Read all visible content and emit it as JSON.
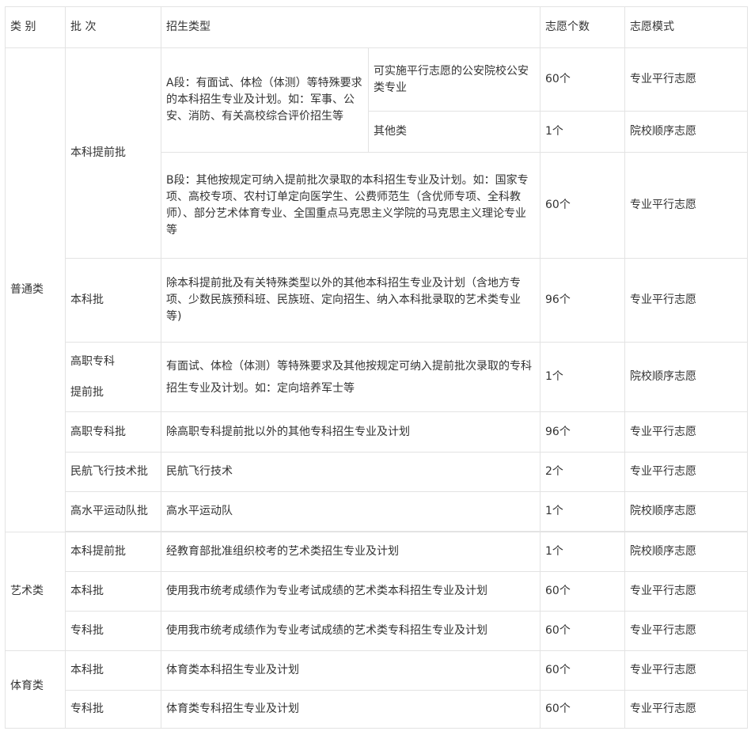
{
  "header": {
    "category": "类 别",
    "batch": "批 次",
    "type": "招生类型",
    "count": "志愿个数",
    "mode": "志愿模式"
  },
  "putong": {
    "category": "普通类",
    "benke_tiqian": {
      "batch": "本科提前批",
      "a_section": "A段：有面试、体检（体测）等特殊要求的本科招生专业及计划。如：军事、公安、消防、有关高校综合评价招生等",
      "a1": {
        "type": "可实施平行志愿的公安院校公安类专业",
        "count": "60个",
        "mode": "专业平行志愿"
      },
      "a2": {
        "type": "其他类",
        "count": "1个",
        "mode": "院校顺序志愿"
      },
      "b": {
        "type": "B段：其他按规定可纳入提前批次录取的本科招生专业及计划。如：国家专项、高校专项、农村订单定向医学生、公费师范生（含优师专项、全科教师）、部分艺术体育专业、全国重点马克思主义学院的马克思主义理论专业等",
        "count": "60个",
        "mode": "专业平行志愿"
      }
    },
    "benke": {
      "batch": "本科批",
      "type": "除本科提前批及有关特殊类型以外的其他本科招生专业及计划（含地方专项、少数民族预科班、民族班、定向招生、纳入本科批录取的艺术类专业等)",
      "count": "96个",
      "mode": "专业平行志愿"
    },
    "gaozhi_tiqian": {
      "batch_line1": "高职专科",
      "batch_line2": "提前批",
      "type": "有面试、体检（体测）等特殊要求及其他按规定可纳入提前批次录取的专科招生专业及计划。如：定向培养军士等",
      "count": "1个",
      "mode": "院校顺序志愿"
    },
    "gaozhi": {
      "batch": "高职专科批",
      "type": "除高职专科提前批以外的其他专科招生专业及计划",
      "count": "96个",
      "mode": "专业平行志愿"
    },
    "minhang": {
      "batch": "民航飞行技术批",
      "type": "民航飞行技术",
      "count": "2个",
      "mode": "专业平行志愿"
    },
    "gaoshuiping": {
      "batch": "高水平运动队批",
      "type": "高水平运动队",
      "count": "1个",
      "mode": "院校顺序志愿"
    }
  },
  "yishu": {
    "category": "艺术类",
    "rows": [
      {
        "batch": "本科提前批",
        "type": "经教育部批准组织校考的艺术类招生专业及计划",
        "count": "1个",
        "mode": "院校顺序志愿"
      },
      {
        "batch": "本科批",
        "type": "使用我市统考成绩作为专业考试成绩的艺术类本科招生专业及计划",
        "count": "60个",
        "mode": "专业平行志愿"
      },
      {
        "batch": "专科批",
        "type": "使用我市统考成绩作为专业考试成绩的艺术类专科招生专业及计划",
        "count": "60个",
        "mode": "专业平行志愿"
      }
    ]
  },
  "tiyu": {
    "category": "体育类",
    "rows": [
      {
        "batch": "本科批",
        "type": "体育类本科招生专业及计划",
        "count": "60个",
        "mode": "专业平行志愿"
      },
      {
        "batch": "专科批",
        "type": "体育类专科招生专业及计划",
        "count": "60个",
        "mode": "专业平行志愿"
      }
    ]
  }
}
